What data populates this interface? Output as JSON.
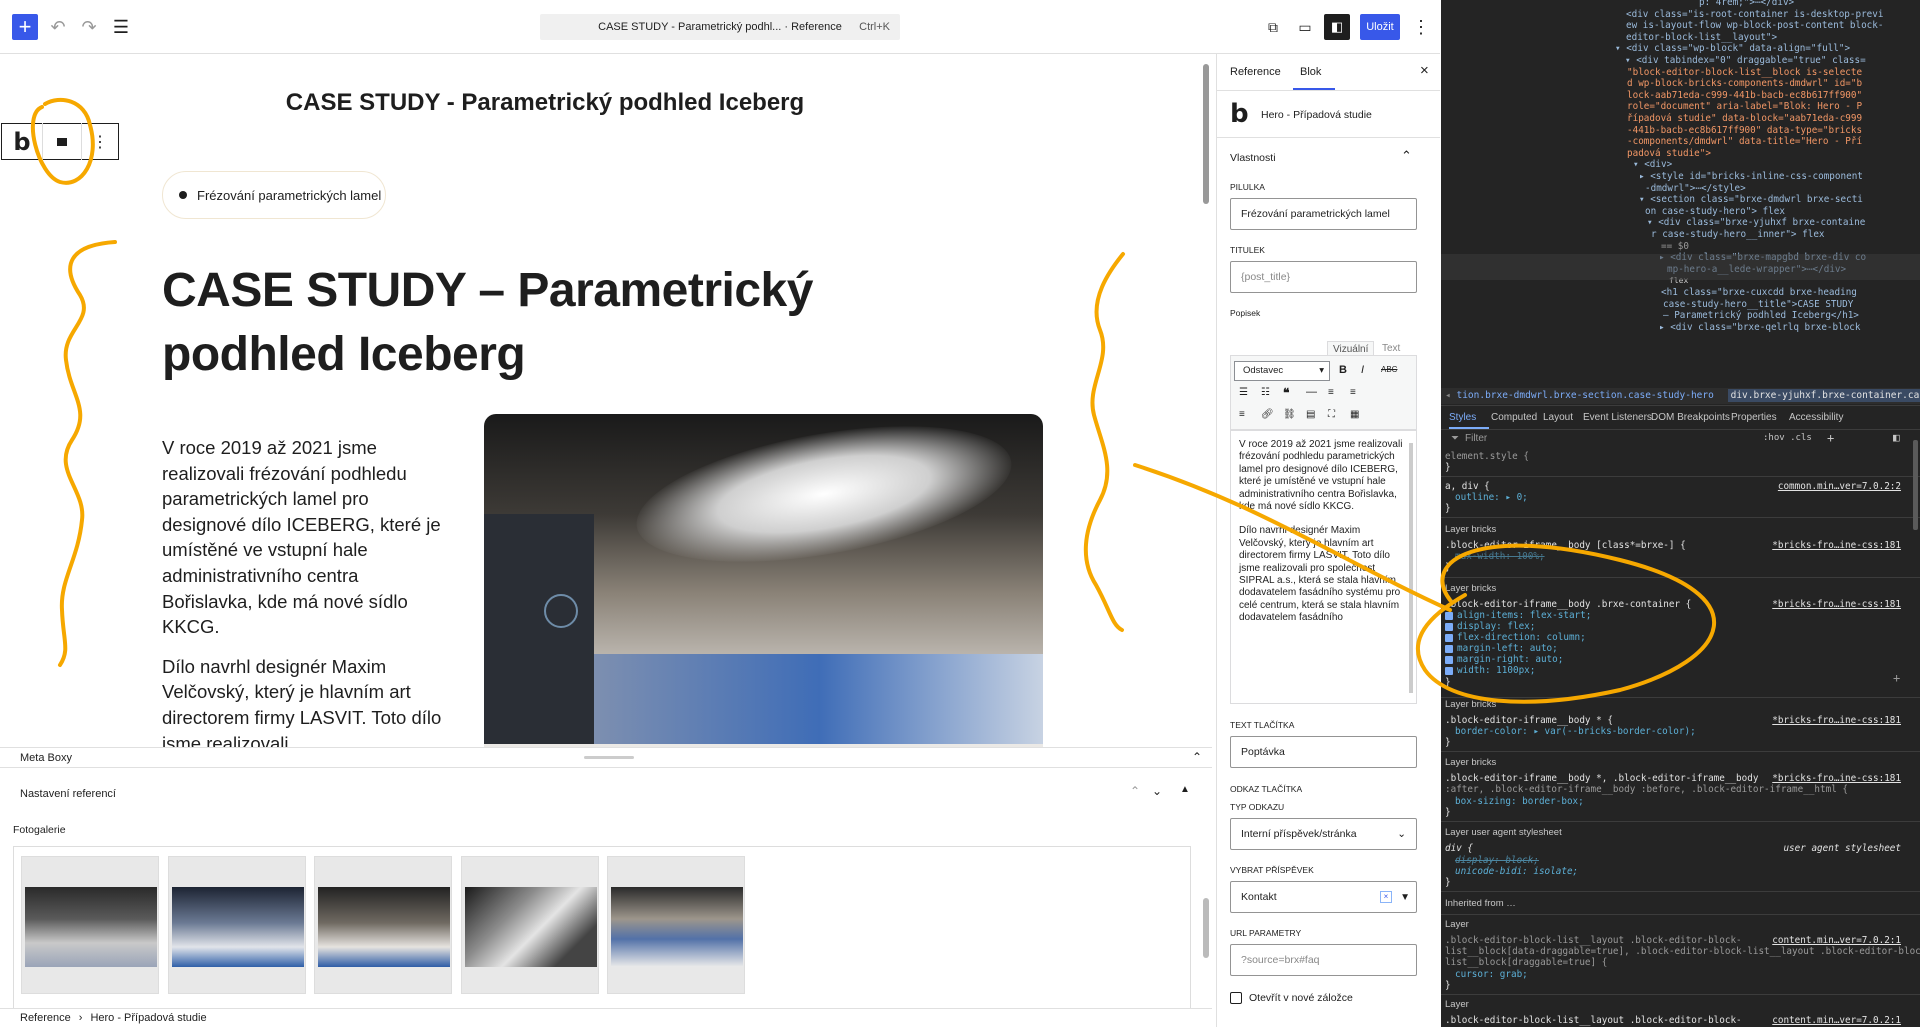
{
  "topbar": {
    "command_text": "CASE STUDY - Parametrický podhl... · Reference",
    "command_shortcut": "Ctrl+K",
    "save_label": "Uložit"
  },
  "canvas": {
    "page_title": "CASE STUDY - Parametrický podhled Iceberg",
    "pill_text": "Frézování parametrických lamel",
    "hero_title_line1": "CASE STUDY – Parametrický",
    "hero_title_line2": "podhled Iceberg",
    "paragraph1": "V roce 2019 až 2021 jsme realizovali frézování podhledu parametrických lamel pro designové dílo ICEBERG, které je umístěné ve vstupní hale administrativního centra Bořislavka, kde má nové sídlo KKCG.",
    "paragraph2": "Dílo navrhl designér Maxim Velčovský, který je hlavním art directorem firmy LASVIT. Toto dílo jsme realizovali",
    "block_toolbar_logo": "b"
  },
  "metabox": {
    "panel_title": "Meta Boxy",
    "section_title": "Nastavení referencí",
    "gallery_label": "Fotogalerie"
  },
  "statusbar": {
    "crumb1": "Reference",
    "crumb2": "Hero - Případová studie"
  },
  "sidebar": {
    "tab_reference": "Reference",
    "tab_block": "Blok",
    "block_logo": "b",
    "block_name": "Hero - Případová studie",
    "panel_title": "Vlastnosti",
    "pilulka_label": "PILULKA",
    "pilulka_value": "Frézování parametrických lamel",
    "titulek_label": "TITULEK",
    "titulek_placeholder": "{post_title}",
    "popisek_label": "Popisek",
    "visual_tab": "Vizuální",
    "text_tab": "Text",
    "format_select": "Odstavec",
    "editor_p1": "V roce 2019 až 2021 jsme realizovali frézování podhledu parametrických lamel pro designové dílo ICEBERG, které je umístěné ve vstupní hale administrativního centra Bořislavka, kde má nové sídlo KKCG.",
    "editor_p2": "Dílo navrhl designér Maxim Velčovský, který je hlavním art directorem firmy LASVIT. Toto dílo jsme realizovali pro společnost SIPRAL a.s., která se stala hlavním dodavatelem fasádního systému pro celé centrum, která se stala hlavním dodavatelem fasádního",
    "button_text_label": "TEXT TLAČÍTKA",
    "button_text_value": "Poptávka",
    "button_link_label": "ODKAZ TLAČÍTKA",
    "link_type_label": "TYP ODKAZU",
    "link_type_value": "Interní příspěvek/stránka",
    "select_post_label": "VYBRAT PŘÍSPĚVEK",
    "select_post_value": "Kontakt",
    "url_params_label": "URL PARAMETRY",
    "url_params_placeholder": "?source=brx#faq",
    "new_tab_label": "Otevřít v nové záložce"
  },
  "devtools": {
    "dom_lines": [
      "p: 4rem;\">⋯</div>",
      "<div class=\"is-root-container is-desktop-previ",
      "ew is-layout-flow wp-block-post-content block-",
      "editor-block-list__layout\">",
      "▾ <div class=\"wp-block\" data-align=\"full\">",
      "▾ <div tabindex=\"0\" draggable=\"true\" class=",
      "\"block-editor-block-list__block is-selecte",
      "d wp-block-bricks-components-dmdwrl\" id=\"b",
      "lock-aab71eda-c999-441b-bacb-ec8b617ff900\"",
      "role=\"document\" aria-label=\"Blok: Hero - P",
      "řípadová studie\" data-block=\"aab71eda-c999",
      "-441b-bacb-ec8b617ff900\" data-type=\"bricks",
      "-components/dmdwrl\" data-title=\"Hero - Pří",
      "padová studie\">",
      "▾ <div>",
      "▸ <style id=\"bricks-inline-css-component",
      "-dmdwrl\">⋯</style>",
      "▾ <section class=\"brxe-dmdwrl brxe-secti",
      "on case-study-hero\"> flex",
      "▾ <div class=\"brxe-yjuhxf brxe-containe",
      "r case-study-hero__inner\"> flex",
      "== $0",
      "▸ <div class=\"brxe-mapgbd brxe-div co",
      "mp-hero-a__lede-wrapper\">⋯</div>",
      "flex",
      "<h1 class=\"brxe-cuxcdd brxe-heading",
      "case-study-hero__title\">CASE STUDY",
      "– Parametrický podhled Iceberg</h1>",
      "▸ <div class=\"brxe-qelrlq brxe-block"
    ],
    "breadcrumb1": "tion.brxe-dmdwrl.brxe-section.case-study-hero",
    "breadcrumb2": "div.brxe-yjuhxf.brxe-container.case-study-hero__inner",
    "tabs": [
      "Styles",
      "Computed",
      "Layout",
      "Event Listeners",
      "DOM Breakpoints",
      "Properties",
      "Accessibility"
    ],
    "filter_placeholder": "Filter",
    "filter_tools": ":hov .cls",
    "rules": {
      "element_style": "element.style {",
      "r1_sel": "a, div {",
      "r1_src": "common.min…ver=7.0.2:2",
      "r1_prop": "outline: ▸ 0;",
      "layer_bricks": "Layer bricks",
      "r2_sel": ".block-editor-iframe__body [class*=brxe-] {",
      "r2_src": "*bricks-fro…ine-css:181",
      "r2_prop": "max-width: 100%;",
      "r3_sel": ".block-editor-iframe__body .brxe-container {",
      "r3_src": "*bricks-fro…ine-css:181",
      "r3_props": [
        "align-items: flex-start;",
        "display: flex;",
        "flex-direction: column;",
        "margin-left: auto;",
        "margin-right: auto;",
        "width: 1100px;"
      ],
      "r4_sel": ".block-editor-iframe__body * {",
      "r4_src": "*bricks-fro…ine-css:181",
      "r4_prop": "border-color: ▸ var(--bricks-border-color);",
      "r5_sel": ".block-editor-iframe__body *, .block-editor-iframe__body",
      "r5_sel2": ":after, .block-editor-iframe__body :before, .block-editor-iframe__html {",
      "r5_src": "*bricks-fro…ine-css:181",
      "r5_prop": "box-sizing: border-box;",
      "layer_ua": "Layer user agent stylesheet",
      "r6_sel": "div {",
      "r6_src": "user agent stylesheet",
      "r6_prop1": "display: block;",
      "r6_prop2": "unicode-bidi: isolate;",
      "inherited": "Inherited from …",
      "layer": "Layer",
      "r7_sel": ".block-editor-block-list__layout .block-editor-block-",
      "r7_sel2": "list__block[data-draggable=true], .block-editor-block-list__layout .block-editor-block-",
      "r7_sel3": "list__block[draggable=true] {",
      "r7_src": "content.min…ver=7.0.2:1",
      "r7_prop": "cursor: grab;",
      "layer2": "Layer",
      "r8_sel": ".block-editor-block-list__layout .block-editor-block-",
      "r8_src": "content.min…ver=7.0.2:1"
    }
  },
  "colors": {
    "accent_blue": "#3858e9",
    "annotation_orange": "#f6a800",
    "devtools_bg": "#242424"
  }
}
